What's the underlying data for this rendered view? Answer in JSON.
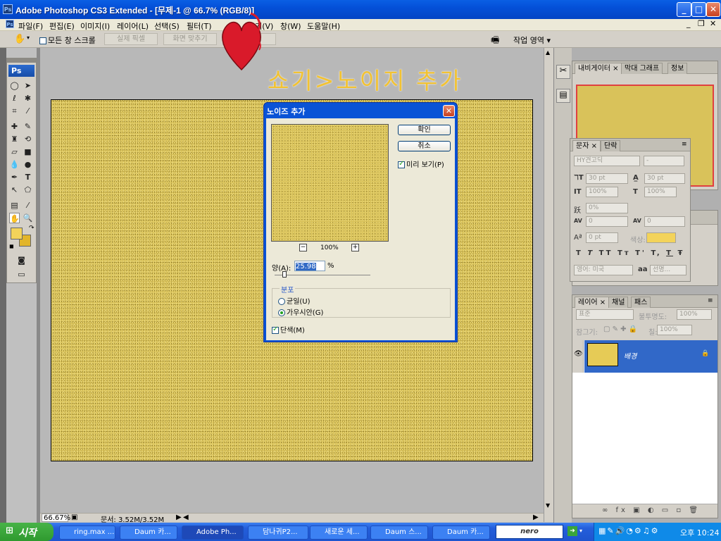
{
  "window": {
    "title": "Adobe Photoshop CS3 Extended - [무제-1 @ 66.7% (RGB/8)]",
    "app_icon": "ps-icon"
  },
  "menu": [
    "파일(F)",
    "편집(E)",
    "이미지(I)",
    "레이어(L)",
    "선택(S)",
    "필터(T)",
    "보기(V)",
    "창(W)",
    "도움말(H)"
  ],
  "options_bar": {
    "scroll_all_label": "모든 창 스크롤",
    "actual_pixels": "실제 픽셀",
    "fit_screen": "화면 맞추기",
    "workspace_label": "작업 영역 ▾"
  },
  "annotation": "쇼기>노이지 추가",
  "toolbox": {
    "logo": "Ps"
  },
  "dialog": {
    "title": "노이즈 추가",
    "ok": "확인",
    "cancel": "취소",
    "preview_label": "미리 보기(P)",
    "preview_checked": true,
    "zoom": "100%",
    "amount_label": "양(A):",
    "amount_value": "25.98",
    "amount_unit": "%",
    "amount_slider_fraction": 0.1,
    "distribution_group": "분포",
    "uniform": "균일(U)",
    "gaussian": "가우시안(G)",
    "distribution_selected": "gaussian",
    "monochrome": "단색(M)",
    "monochrome_checked": true
  },
  "statusbar": {
    "zoom": "66.67%",
    "doc": "문서: 3.52M/3.52M"
  },
  "navigator_panel": {
    "tabs": [
      "내비게이터",
      "막대 그래프",
      "정보"
    ]
  },
  "character_panel": {
    "tabs": [
      "문자",
      "단락"
    ],
    "font": "HY견고딕",
    "font_style": "-",
    "size": "30 pt",
    "leading": "30 pt",
    "v_scale": "100%",
    "h_scale": "100%",
    "baseline": "0%",
    "kerning": "0",
    "tracking": "0",
    "shift": "0 pt",
    "color_label": "색상:",
    "language": "영어: 미국",
    "aa_label": "aa",
    "antialias": "선명...",
    "styles": [
      "T",
      "T",
      "TT",
      "Tт",
      "T'",
      "T,",
      "T",
      "Ŧ"
    ]
  },
  "layers_panel": {
    "tabs": [
      "레이어",
      "채널",
      "패스"
    ],
    "blend": "표준",
    "opacity_label": "불투명도:",
    "opacity": "100%",
    "lock_label": "잠그기:",
    "fill_label": "칠:",
    "fill": "100%",
    "layer_name": "배경"
  },
  "taskbar": {
    "start": "시작",
    "tasks": [
      "ring.max ...",
      "Daum 카...",
      "Adobe Ph...",
      "담나귀P2...",
      "새로운 세...",
      "Daum 스...",
      "Daum 카..."
    ],
    "active_task": 2,
    "clock": "오후 10:24",
    "nero_label": "nero"
  },
  "colors": {
    "foreground": "#f3d35a",
    "background": "#e2b52a",
    "canvas": "#d9c25a",
    "layer_highlight": "#3168c8"
  }
}
